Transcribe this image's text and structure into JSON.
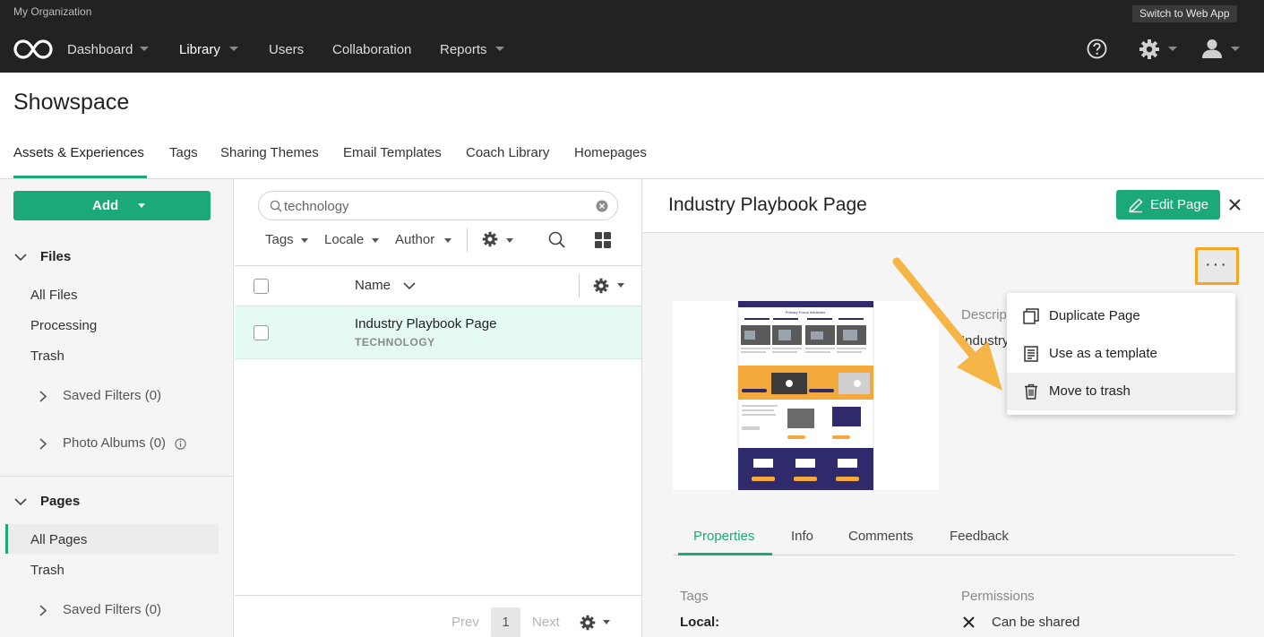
{
  "topbar": {
    "org_name": "My Organization",
    "switch_label": "Switch to Web App",
    "nav": [
      {
        "label": "Dashboard"
      },
      {
        "label": "Library"
      },
      {
        "label": "Users"
      },
      {
        "label": "Collaboration"
      },
      {
        "label": "Reports"
      }
    ],
    "icons": [
      "help-icon",
      "settings-icon",
      "user-icon"
    ]
  },
  "header": {
    "title": "Showspace",
    "tabs": [
      "Assets & Experiences",
      "Tags",
      "Sharing Themes",
      "Email Templates",
      "Coach Library",
      "Homepages"
    ],
    "active_tab": "Assets & Experiences"
  },
  "sidebar": {
    "add_label": "Add",
    "files": {
      "heading": "Files",
      "links": [
        "All Files",
        "Processing",
        "Trash"
      ],
      "subs": [
        "Saved Filters (0)",
        "Photo Albums (0)"
      ]
    },
    "pages": {
      "heading": "Pages",
      "links": [
        "All Pages",
        "Trash"
      ],
      "subs": [
        "Saved Filters (0)"
      ],
      "active": "All Pages"
    }
  },
  "list": {
    "search_value": "technology",
    "filters": [
      "Tags",
      "Locale",
      "Author"
    ],
    "column_name": "Name",
    "rows": [
      {
        "title": "Industry Playbook Page",
        "tag": "TECHNOLOGY"
      }
    ],
    "pager": {
      "prev": "Prev",
      "page": "1",
      "next": "Next"
    }
  },
  "detail": {
    "title": "Industry Playbook Page",
    "edit_label": "Edit Page",
    "description_label": "Descrip",
    "description_value": "Industry",
    "tabs": [
      "Properties",
      "Info",
      "Comments",
      "Feedback"
    ],
    "active_tab": "Properties",
    "tags_label": "Tags",
    "permissions_label": "Permissions",
    "local_label": "Local:",
    "permission_value": "Can be shared",
    "thumbnail": {
      "heading": "Primary Focus Industries"
    }
  },
  "menu": {
    "items": [
      {
        "label": "Duplicate Page",
        "icon": "duplicate-icon"
      },
      {
        "label": "Use as a template",
        "icon": "template-icon"
      },
      {
        "label": "Move to trash",
        "icon": "trash-icon"
      }
    ],
    "highlighted": "Move to trash"
  },
  "colors": {
    "accent": "#1ba97a",
    "topbar": "#222222",
    "highlight": "#f5a623",
    "selected_row": "#e4faf3"
  }
}
